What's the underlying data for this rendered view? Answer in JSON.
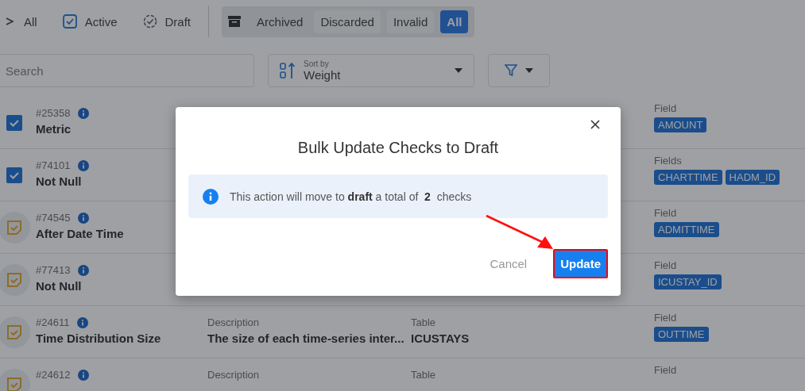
{
  "status_tabs": [
    {
      "label": "All",
      "kind": "all",
      "selected": false
    },
    {
      "label": "Active",
      "kind": "active",
      "selected": false
    },
    {
      "label": "Draft",
      "kind": "draft",
      "selected": false
    }
  ],
  "archive_group": {
    "label": "Archived",
    "options": [
      {
        "label": "Discarded",
        "selected": false
      },
      {
        "label": "Invalid",
        "selected": false
      },
      {
        "label": "All",
        "selected": true
      }
    ]
  },
  "search": {
    "placeholder": "Search"
  },
  "sort": {
    "label": "Sort by",
    "value": "Weight"
  },
  "checks": [
    {
      "id": "#25358",
      "name": "Metric",
      "checked": true,
      "field_label": "Field",
      "fields": [
        "AMOUNT"
      ]
    },
    {
      "id": "#74101",
      "name": "Not Null",
      "checked": true,
      "field_label": "Fields",
      "fields": [
        "CHARTTIME",
        "HADM_ID"
      ]
    },
    {
      "id": "#74545",
      "name": "After Date Time",
      "checked": false,
      "field_label": "Field",
      "fields": [
        "ADMITTIME"
      ]
    },
    {
      "id": "#77413",
      "name": "Not Null",
      "checked": false,
      "field_label": "Field",
      "fields": [
        "ICUSTAY_ID"
      ]
    },
    {
      "id": "#24611",
      "name": "Time Distribution Size",
      "checked": false,
      "description_label": "Description",
      "description": "The size of each time-series inter...",
      "table_label": "Table",
      "table": "ICUSTAYS",
      "field_label": "Field",
      "fields": [
        "OUTTIME"
      ]
    },
    {
      "id": "#24612",
      "checked": false,
      "description_label": "Description",
      "table_label": "Table",
      "field_label": "Field"
    }
  ],
  "dialog": {
    "title": "Bulk Update Checks to Draft",
    "message": "This action will move to **draft** a total of  **2**  checks",
    "buttons": [
      {
        "label": "Cancel",
        "kind": "secondary",
        "highlighted": false
      },
      {
        "label": "Update",
        "kind": "primary",
        "highlighted": true
      }
    ]
  }
}
